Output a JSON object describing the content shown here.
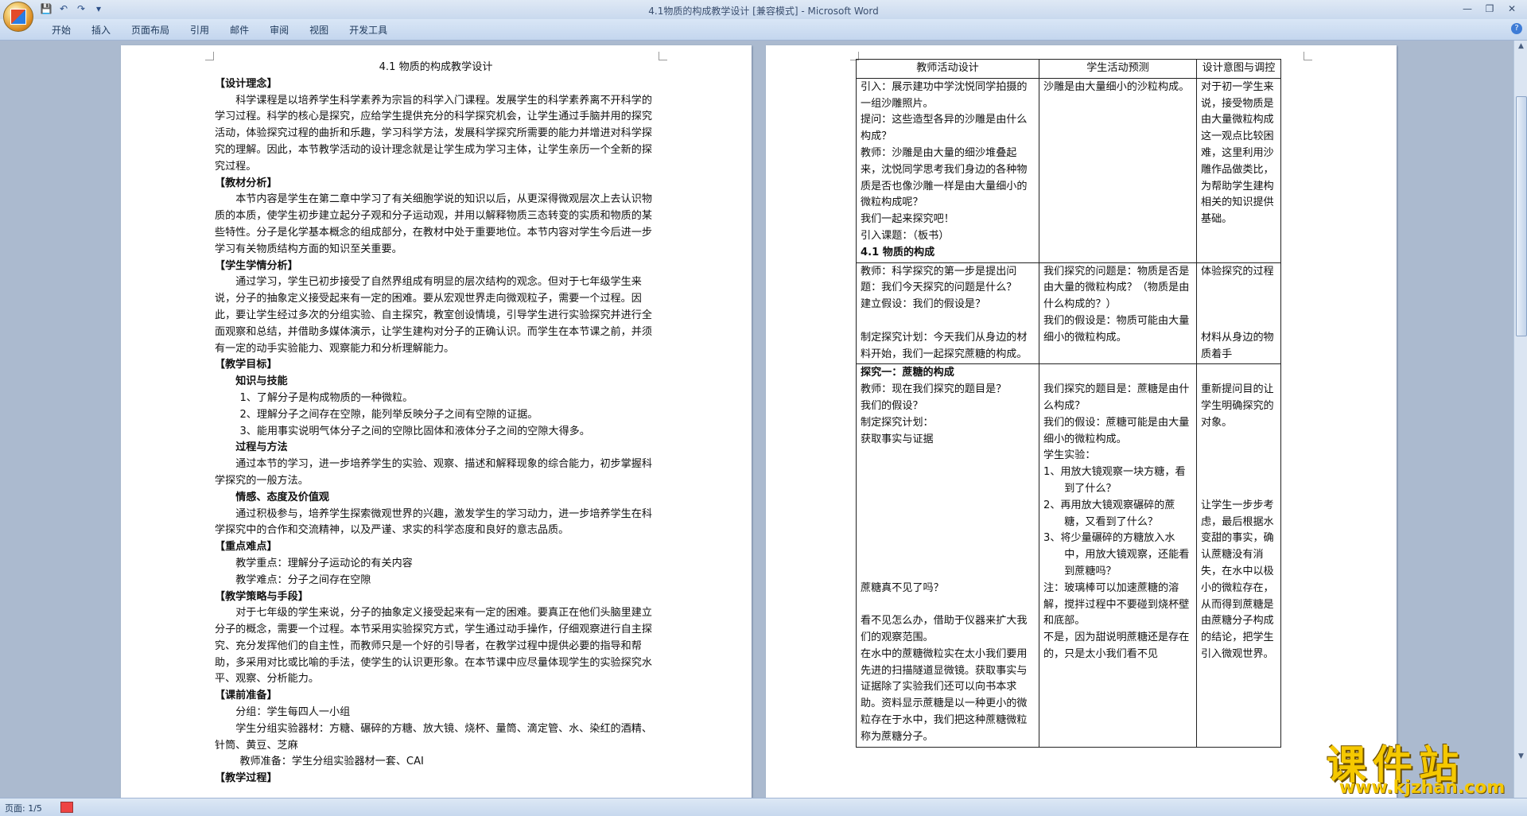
{
  "window": {
    "title": "4.1物质的构成教学设计 [兼容模式] - Microsoft Word"
  },
  "ribbon": {
    "tabs": [
      "开始",
      "插入",
      "页面布局",
      "引用",
      "邮件",
      "审阅",
      "视图",
      "开发工具"
    ]
  },
  "page1": {
    "title": "4.1 物质的构成教学设计",
    "lines": [
      {
        "t": "【设计理念】",
        "c": "h"
      },
      {
        "t": "科学课程是以培养学生科学素养为宗旨的科学入门课程。发展学生的科学素养离不开科学的学习过程。科学的核心是探究，应给学生提供充分的科学探究机会，让学生通过手脑并用的探究活动，体验探究过程的曲折和乐趣，学习科学方法，发展科学探究所需要的能力并增进对科学探究的理解。因此，本节教学活动的设计理念就是让学生成为学习主体，让学生亲历一个全新的探究过程。",
        "c": "ind"
      },
      {
        "t": "【教材分析】",
        "c": "h"
      },
      {
        "t": "本节内容是学生在第二章中学习了有关细胞学说的知识以后，从更深得微观层次上去认识物质的本质，使学生初步建立起分子观和分子运动观，并用以解释物质三态转变的实质和物质的某些特性。分子是化学基本概念的组成部分，在教材中处于重要地位。本节内容对学生今后进一步学习有关物质结构方面的知识至关重要。",
        "c": "ind"
      },
      {
        "t": "【学生学情分析】",
        "c": "h"
      },
      {
        "t": "通过学习，学生已初步接受了自然界组成有明显的层次结构的观念。但对于七年级学生来说，分子的抽象定义接受起来有一定的困难。要从宏观世界走向微观粒子，需要一个过程。因此，要让学生经过多次的分组实验、自主探究，教室创设情境，引导学生进行实验探究并进行全面观察和总结，并借助多媒体演示，让学生建构对分子的正确认识。而学生在本节课之前，并须有一定的动手实验能力、观察能力和分析理解能力。",
        "c": "ind"
      },
      {
        "t": "【教学目标】",
        "c": "h"
      },
      {
        "t": "知识与技能",
        "c": "ind1 bold"
      },
      {
        "t": "1、了解分子是构成物质的一种微粒。",
        "c": "ind15"
      },
      {
        "t": "2、理解分子之间存在空隙，能列举反映分子之间有空隙的证据。",
        "c": "ind15"
      },
      {
        "t": "3、能用事实说明气体分子之间的空隙比固体和液体分子之间的空隙大得多。",
        "c": "ind15"
      },
      {
        "t": "过程与方法",
        "c": "ind1 bold"
      },
      {
        "t": "通过本节的学习，进一步培养学生的实验、观察、描述和解释现象的综合能力，初步掌握科学探究的一般方法。",
        "c": "ind"
      },
      {
        "t": "情感、态度及价值观",
        "c": "ind1 bold"
      },
      {
        "t": "通过积极参与，培养学生探索微观世界的兴趣，激发学生的学习动力，进一步培养学生在科学探究中的合作和交流精神，以及严谨、求实的科学态度和良好的意志品质。",
        "c": "ind"
      },
      {
        "t": "【重点难点】",
        "c": "h"
      },
      {
        "t": "教学重点：理解分子运动论的有关内容",
        "c": "ind1"
      },
      {
        "t": "教学难点：分子之间存在空隙",
        "c": "ind1"
      },
      {
        "t": "【教学策略与手段】",
        "c": "h"
      },
      {
        "t": "对于七年级的学生来说，分子的抽象定义接受起来有一定的困难。要真正在他们头脑里建立分子的概念，需要一个过程。本节采用实验探究方式，学生通过动手操作，仔细观察进行自主探究、充分发挥他们的自主性，而教师只是一个好的引导者，在教学过程中提供必要的指导和帮助，多采用对比或比喻的手法，使学生的认识更形象。在本节课中应尽量体现学生的实验探究水平、观察、分析能力。",
        "c": "ind"
      },
      {
        "t": "【课前准备】",
        "c": "h"
      },
      {
        "t": "分组：学生每四人一小组",
        "c": "ind1"
      },
      {
        "t": "学生分组实验器材：方糖、碾碎的方糖、放大镜、烧杯、量筒、滴定管、水、染红的酒精、针筒、黄豆、芝麻",
        "c": "ind"
      },
      {
        "t": "教师准备：学生分组实验器材一套、CAI",
        "c": "ind15"
      },
      {
        "t": "【教学过程】",
        "c": "h"
      }
    ]
  },
  "page2": {
    "headers": [
      "教师活动设计",
      "学生活动预测",
      "设计意图与调控"
    ],
    "rows": [
      {
        "teacher": [
          "引入：展示建功中学沈悦同学拍摄的一组沙雕照片。",
          "提问：这些造型各异的沙雕是由什么构成？",
          "教师：沙雕是由大量的细沙堆叠起来，沈悦同学思考我们身边的各种物质是否也像沙雕一样是由大量细小的微粒构成呢？",
          "我们一起来探究吧！",
          "引入课题：（板书）",
          "4.1 物质的构成"
        ],
        "student": [
          "沙雕是由大量细小的沙粒构成。"
        ],
        "intent": [
          "对于初一学生来说，接受物质是由大量微粒构成这一观点比较困难，这里利用沙雕作品做类比，为帮助学生建构相关的知识提供基础。"
        ]
      },
      {
        "teacher": [
          "教师：科学探究的第一步是提出问题：我们今天探究的问题是什么？",
          "建立假设：我们的假设是？",
          "",
          "制定探究计划：今天我们从身边的材料开始，我们一起探究蔗糖的构成。"
        ],
        "student": [
          "我们探究的问题是：物质是否是由大量的微粒构成？（物质是由什么构成的？）",
          "我们的假设是：物质可能由大量细小的微粒构成。"
        ],
        "intent": [
          "体验探究的过程",
          "",
          "",
          "",
          "材料从身边的物质着手"
        ]
      },
      {
        "teacher": [
          "探究一：蔗糖的构成",
          "教师：现在我们探究的题目是？",
          "我们的假设？",
          "制定探究计划：",
          "获取事实与证据",
          "",
          "",
          "",
          "",
          "",
          "",
          "",
          "",
          "蔗糖真不见了吗？",
          "",
          "看不见怎么办，借助于仪器来扩大我们的观察范围。",
          "在水中的蔗糖微粒实在太小我们要用先进的扫描隧道显微镜。获取事实与证据除了实验我们还可以向书本求助。资料显示蔗糖是以一种更小的微粒存在于水中，我们把这种蔗糖微粒称为蔗糖分子。"
        ],
        "student": [
          "",
          "我们探究的题目是：蔗糖是由什么构成？",
          "我们的假设：蔗糖可能是由大量细小的微粒构成。",
          "学生实验：",
          "1、用放大镜观察一块方糖，看到了什么？",
          "2、再用放大镜观察碾碎的蔗糖，又看到了什么？",
          "3、将少量碾碎的方糖放入水中，用放大镜观察，还能看到蔗糖吗？",
          "注：玻璃棒可以加速蔗糖的溶解，搅拌过程中不要碰到烧杯壁和底部。",
          "不是，因为甜说明蔗糖还是存在的，只是太小我们看不见"
        ],
        "intent": [
          "",
          "重新提问目的让学生明确探究的对象。",
          "",
          "",
          "",
          "",
          "让学生一步步考虑，最后根据水变甜的事实，确认蔗糖没有消失，在水中以极小的微粒存在，从而得到蔗糖是由蔗糖分子构成的结论，把学生引入微观世界。"
        ]
      }
    ]
  },
  "status": {
    "page_indicator": "页面: 1/5"
  },
  "watermark": {
    "brand": "课件站",
    "url": "www.kjzhan.com"
  },
  "colors": {
    "app_bg": "#abbacf",
    "ribbon": "#c4d6ee",
    "watermark": "#f5c800"
  }
}
